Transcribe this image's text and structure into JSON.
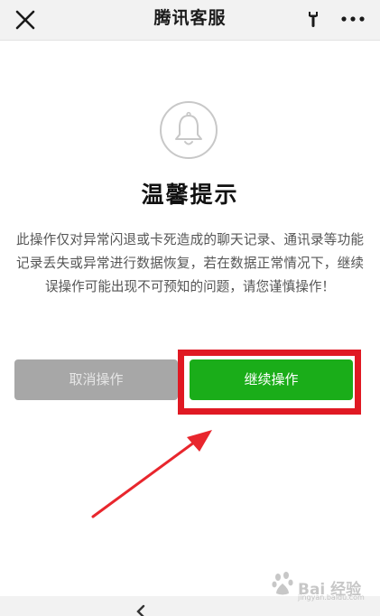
{
  "navbar": {
    "title": "腾讯客服",
    "close_icon": "close-icon",
    "tool_icon": "wrench-icon",
    "more_icon": "more-icon"
  },
  "dialog": {
    "icon": "bell-icon",
    "heading": "温馨提示",
    "message": "此操作仅对异常闪退或卡死造成的聊天记录、通讯录等功能记录丢失或异常进行数据恢复，若在数据正常情况下，继续误操作可能出现不可预知的问题，请您谨慎操作！",
    "cancel_label": "取消操作",
    "continue_label": "继续操作"
  },
  "annotation": {
    "highlight_color": "#e01923",
    "arrow_color": "#e8262d"
  },
  "colors": {
    "accent_green": "#1aad19",
    "cancel_gray": "#a7a7a7",
    "navbar_bg": "#f2f2f2"
  },
  "watermark": {
    "text": "Bai 经验",
    "sub": "jingyan.baidu.com"
  }
}
